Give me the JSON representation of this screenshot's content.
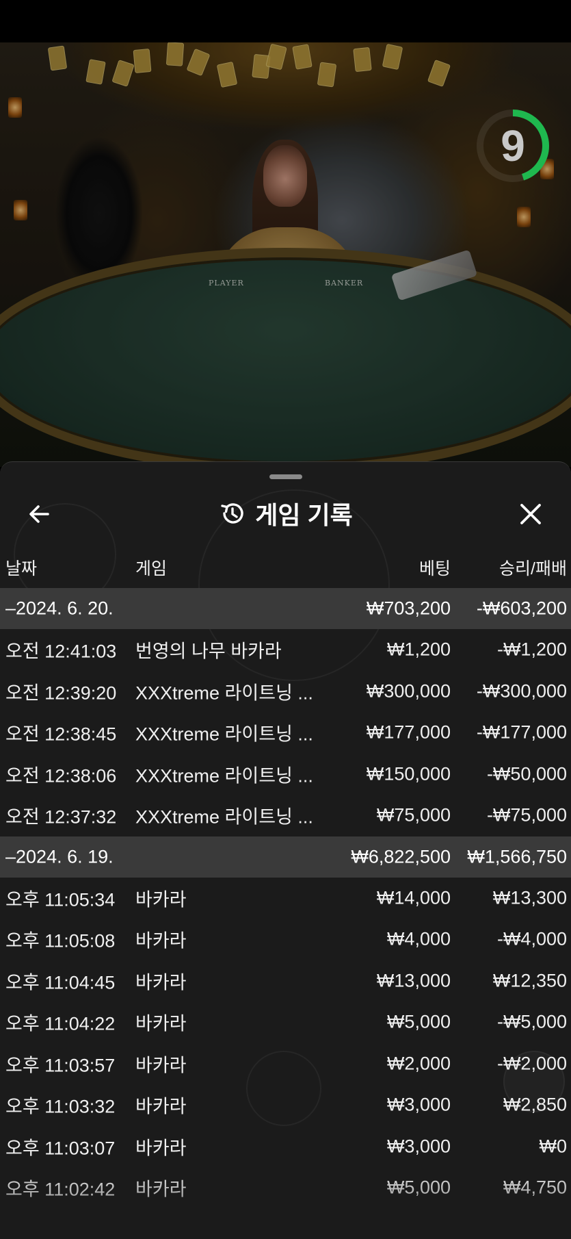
{
  "stream": {
    "countdown": "9",
    "countdown_fraction": 0.45,
    "countdown_color": "#1fb84f",
    "table_labels": {
      "player": "PLAYER",
      "banker": "BANKER"
    }
  },
  "history": {
    "title": "게임 기록",
    "back_icon": "arrow-left-icon",
    "history_icon": "history-clock-icon",
    "close_icon": "close-icon",
    "columns": {
      "date": "날짜",
      "game": "게임",
      "bet": "베팅",
      "win_loss": "승리/패배"
    },
    "groups": [
      {
        "date": "–2024. 6. 20.",
        "bet_total": "₩703,200",
        "win_total": "-₩603,200",
        "rows": [
          {
            "time": "오전 12:41:03",
            "game": "번영의 나무 바카라",
            "bet": "₩1,200",
            "win": "-₩1,200"
          },
          {
            "time": "오전 12:39:20",
            "game": "XXXtreme 라이트닝 ...",
            "bet": "₩300,000",
            "win": "-₩300,000"
          },
          {
            "time": "오전 12:38:45",
            "game": "XXXtreme 라이트닝 ...",
            "bet": "₩177,000",
            "win": "-₩177,000"
          },
          {
            "time": "오전 12:38:06",
            "game": "XXXtreme 라이트닝 ...",
            "bet": "₩150,000",
            "win": "-₩50,000"
          },
          {
            "time": "오전 12:37:32",
            "game": "XXXtreme 라이트닝 ...",
            "bet": "₩75,000",
            "win": "-₩75,000"
          }
        ]
      },
      {
        "date": "–2024. 6. 19.",
        "bet_total": "₩6,822,500",
        "win_total": "₩1,566,750",
        "rows": [
          {
            "time": "오후 11:05:34",
            "game": "바카라",
            "bet": "₩14,000",
            "win": "₩13,300"
          },
          {
            "time": "오후 11:05:08",
            "game": "바카라",
            "bet": "₩4,000",
            "win": "-₩4,000"
          },
          {
            "time": "오후 11:04:45",
            "game": "바카라",
            "bet": "₩13,000",
            "win": "₩12,350"
          },
          {
            "time": "오후 11:04:22",
            "game": "바카라",
            "bet": "₩5,000",
            "win": "-₩5,000"
          },
          {
            "time": "오후 11:03:57",
            "game": "바카라",
            "bet": "₩2,000",
            "win": "-₩2,000"
          },
          {
            "time": "오후 11:03:32",
            "game": "바카라",
            "bet": "₩3,000",
            "win": "₩2,850"
          },
          {
            "time": "오후 11:03:07",
            "game": "바카라",
            "bet": "₩3,000",
            "win": "₩0"
          },
          {
            "time": "오후 11:02:42",
            "game": "바카라",
            "bet": "₩5,000",
            "win": "₩4,750"
          }
        ]
      }
    ]
  }
}
